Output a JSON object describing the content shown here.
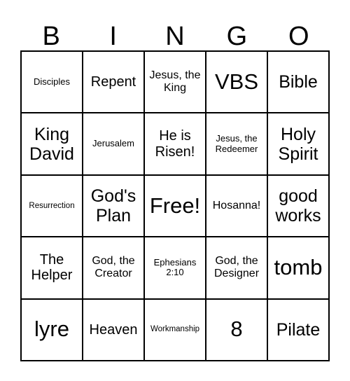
{
  "card": {
    "title": "BINGO Card",
    "header_letters": [
      "B",
      "I",
      "N",
      "G",
      "O"
    ],
    "colors": {
      "text": "#000000",
      "border": "#000000",
      "background": "#ffffff"
    },
    "rows": [
      [
        {
          "text": "Disciples",
          "size": "s"
        },
        {
          "text": "Repent",
          "size": "l"
        },
        {
          "text": "Jesus, the King",
          "size": "m"
        },
        {
          "text": "VBS",
          "size": "xxl"
        },
        {
          "text": "Bible",
          "size": "xl"
        }
      ],
      [
        {
          "text": "King David",
          "size": "xl"
        },
        {
          "text": "Jerusalem",
          "size": "s"
        },
        {
          "text": "He is Risen!",
          "size": "l"
        },
        {
          "text": "Jesus, the Redeemer",
          "size": "s"
        },
        {
          "text": "Holy Spirit",
          "size": "xl"
        }
      ],
      [
        {
          "text": "Resurrection",
          "size": "xs"
        },
        {
          "text": "God's Plan",
          "size": "xl"
        },
        {
          "text": "Free!",
          "size": "xxl"
        },
        {
          "text": "Hosanna!",
          "size": "m"
        },
        {
          "text": "good works",
          "size": "xl"
        }
      ],
      [
        {
          "text": "The Helper",
          "size": "l"
        },
        {
          "text": "God, the Creator",
          "size": "m"
        },
        {
          "text": "Ephesians 2:10",
          "size": "s"
        },
        {
          "text": "God, the Designer",
          "size": "m"
        },
        {
          "text": "tomb",
          "size": "xxl"
        }
      ],
      [
        {
          "text": "lyre",
          "size": "xxl"
        },
        {
          "text": "Heaven",
          "size": "l"
        },
        {
          "text": "Workmanship",
          "size": "xs"
        },
        {
          "text": "8",
          "size": "xxl"
        },
        {
          "text": "Pilate",
          "size": "xl"
        }
      ]
    ]
  }
}
